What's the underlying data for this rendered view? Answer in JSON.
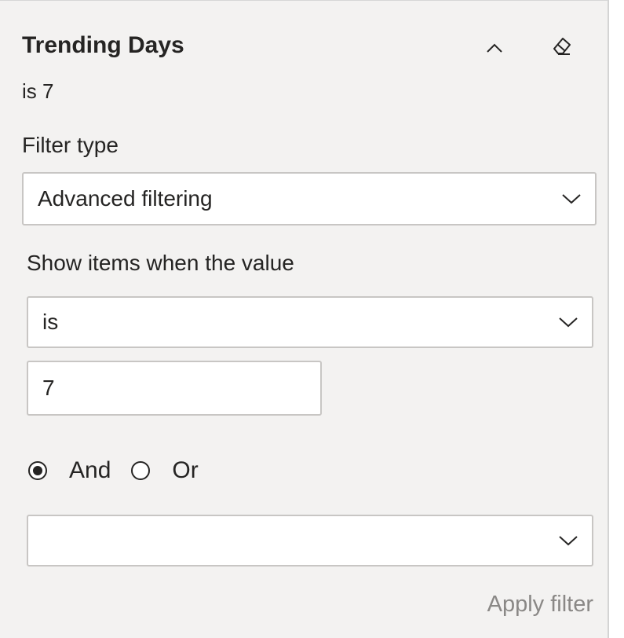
{
  "filter": {
    "title": "Trending Days",
    "summary": "is 7",
    "filter_type_label": "Filter type",
    "filter_type_value": "Advanced filtering",
    "show_items_label": "Show items when the value",
    "condition_1_operator": "is",
    "condition_1_value": "7",
    "logic_and_label": "And",
    "logic_or_label": "Or",
    "logic_selected": "And",
    "condition_2_operator": "",
    "apply_label": "Apply filter"
  },
  "icons": {
    "collapse": "chevron-up-icon",
    "clear": "eraser-icon",
    "dropdown": "chevron-down-icon"
  },
  "colors": {
    "panel_bg": "#f3f2f1",
    "text": "#252423",
    "border": "#c8c6c4",
    "disabled_text": "#8a8886"
  }
}
